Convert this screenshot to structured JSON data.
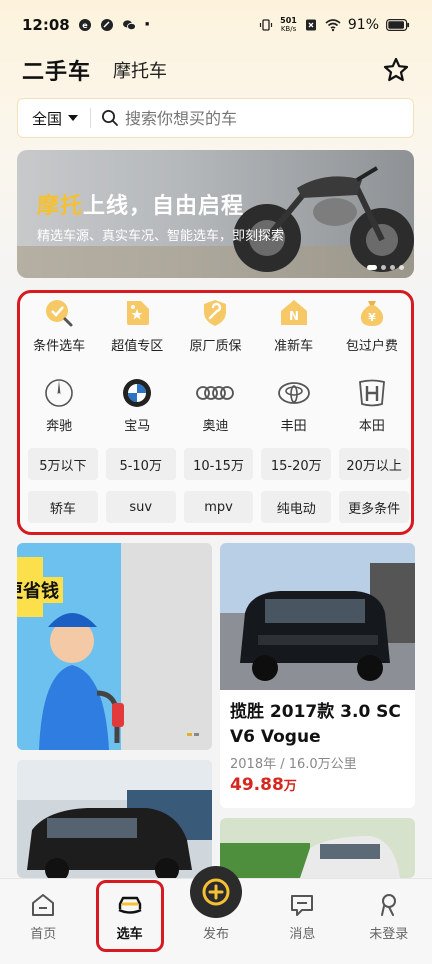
{
  "status_bar": {
    "time": "12:08",
    "net_speed_value": "501",
    "net_speed_unit": "KB/s",
    "battery": "91%"
  },
  "header": {
    "title": "二手车",
    "subtitle": "摩托车",
    "favorite_icon": "star-outline-icon"
  },
  "search": {
    "region": "全国",
    "placeholder": "搜索你想买的车"
  },
  "banner": {
    "title_highlight": "摩托",
    "title_rest": "上线，自由启程",
    "subtitle": "精选车源、真实车况、智能选车，即刻探索"
  },
  "quick_entries": [
    {
      "label": "条件选车",
      "icon": "search-check-icon"
    },
    {
      "label": "超值专区",
      "icon": "value-tag-icon"
    },
    {
      "label": "原厂质保",
      "icon": "wrench-shield-icon"
    },
    {
      "label": "准新车",
      "icon": "new-car-house-icon"
    },
    {
      "label": "包过户费",
      "icon": "money-bag-icon"
    }
  ],
  "brands": [
    {
      "label": "奔驰",
      "icon": "mercedes-logo-icon"
    },
    {
      "label": "宝马",
      "icon": "bmw-logo-icon"
    },
    {
      "label": "奥迪",
      "icon": "audi-logo-icon"
    },
    {
      "label": "丰田",
      "icon": "toyota-logo-icon"
    },
    {
      "label": "本田",
      "icon": "honda-logo-icon"
    }
  ],
  "price_filters": [
    "5万以下",
    "5-10万",
    "10-15万",
    "15-20万",
    "20万以上"
  ],
  "type_filters": [
    "轿车",
    "suv",
    "mpv",
    "纯电动",
    "更多条件"
  ],
  "listings": [
    {
      "title": "揽胜 2017款 3.0 SC V6 Vogue",
      "meta": "2018年 / 16.0万公里",
      "price": "49.88",
      "price_unit": "万"
    }
  ],
  "ad_text": "更省钱",
  "tabs": [
    {
      "label": "首页",
      "icon": "home-icon"
    },
    {
      "label": "选车",
      "icon": "car-select-icon"
    },
    {
      "label": "发布",
      "icon": "publish-plus-icon"
    },
    {
      "label": "消息",
      "icon": "message-icon"
    },
    {
      "label": "未登录",
      "icon": "user-icon"
    }
  ],
  "colors": {
    "accent": "#f5c132",
    "price": "#d7261e",
    "highlight_border": "#d71920"
  }
}
